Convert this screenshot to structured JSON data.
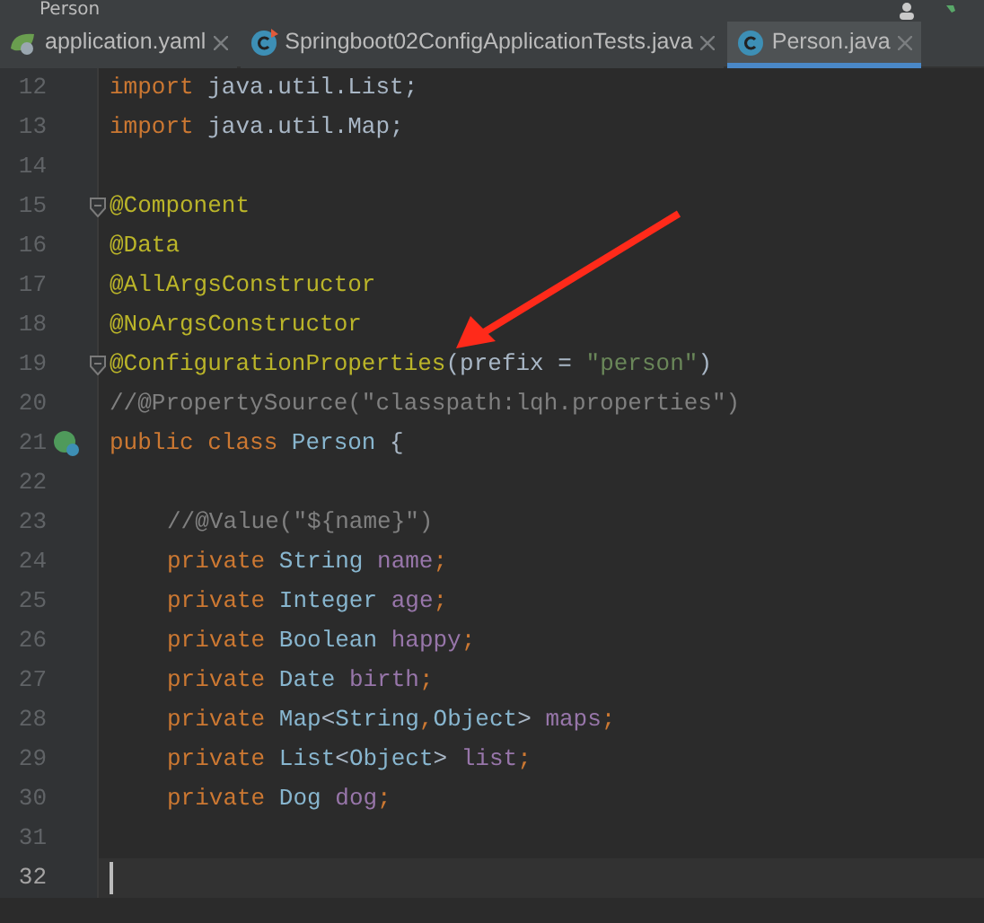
{
  "breadcrumb": "Person",
  "tabs": [
    {
      "label": "application.yaml",
      "kind": "yaml",
      "selected": false
    },
    {
      "label": "Springboot02ConfigApplicationTests.java",
      "kind": "test",
      "selected": false
    },
    {
      "label": "Person.java",
      "kind": "class",
      "selected": true
    }
  ],
  "editor": {
    "lines": [
      {
        "number": "12",
        "tokens": [
          {
            "kind": "keyword",
            "text": "import"
          },
          {
            "kind": "plain",
            "text": " java.util.List;"
          }
        ]
      },
      {
        "number": "13",
        "tokens": [
          {
            "kind": "keyword",
            "text": "import"
          },
          {
            "kind": "plain",
            "text": " java.util.Map;"
          }
        ]
      },
      {
        "number": "14"
      },
      {
        "number": "15",
        "fold": true,
        "tokens": [
          {
            "kind": "annotation",
            "text": "@Component"
          }
        ]
      },
      {
        "number": "16",
        "tokens": [
          {
            "kind": "annotation",
            "text": "@Data"
          }
        ]
      },
      {
        "number": "17",
        "tokens": [
          {
            "kind": "annotation",
            "text": "@AllArgsConstructor"
          }
        ]
      },
      {
        "number": "18",
        "tokens": [
          {
            "kind": "annotation",
            "text": "@NoArgsConstructor"
          }
        ]
      },
      {
        "number": "19",
        "fold": true,
        "tokens": [
          {
            "kind": "annotation",
            "text": "@ConfigurationProperties"
          },
          {
            "kind": "plain",
            "text": "("
          },
          {
            "kind": "param",
            "text": "prefix"
          },
          {
            "kind": "plain",
            "text": " = "
          },
          {
            "kind": "string",
            "text": "\"person\""
          },
          {
            "kind": "plain",
            "text": ")"
          }
        ]
      },
      {
        "number": "20",
        "tokens": [
          {
            "kind": "comment",
            "text": "//@PropertySource(\"classpath:lqh.properties\")"
          }
        ]
      },
      {
        "number": "21",
        "bean": true,
        "tokens": [
          {
            "kind": "keyword",
            "text": "public class "
          },
          {
            "kind": "type",
            "text": "Person"
          },
          {
            "kind": "plain",
            "text": " {"
          }
        ]
      },
      {
        "number": "22"
      },
      {
        "number": "23",
        "indented": true,
        "tokens": [
          {
            "kind": "comment",
            "text": "//@Value(\"${name}\")"
          }
        ]
      },
      {
        "number": "24",
        "indented": true,
        "tokens": [
          {
            "kind": "keyword",
            "text": "private "
          },
          {
            "kind": "type",
            "text": "String "
          },
          {
            "kind": "field",
            "text": "name"
          },
          {
            "kind": "keyword",
            "text": ";"
          }
        ]
      },
      {
        "number": "25",
        "indented": true,
        "tokens": [
          {
            "kind": "keyword",
            "text": "private "
          },
          {
            "kind": "type",
            "text": "Integer "
          },
          {
            "kind": "field",
            "text": "age"
          },
          {
            "kind": "keyword",
            "text": ";"
          }
        ]
      },
      {
        "number": "26",
        "indented": true,
        "tokens": [
          {
            "kind": "keyword",
            "text": "private "
          },
          {
            "kind": "type",
            "text": "Boolean "
          },
          {
            "kind": "field",
            "text": "happy"
          },
          {
            "kind": "keyword",
            "text": ";"
          }
        ]
      },
      {
        "number": "27",
        "indented": true,
        "tokens": [
          {
            "kind": "keyword",
            "text": "private "
          },
          {
            "kind": "type",
            "text": "Date "
          },
          {
            "kind": "field",
            "text": "birth"
          },
          {
            "kind": "keyword",
            "text": ";"
          }
        ]
      },
      {
        "number": "28",
        "indented": true,
        "tokens": [
          {
            "kind": "keyword",
            "text": "private "
          },
          {
            "kind": "type",
            "text": "Map"
          },
          {
            "kind": "plain",
            "text": "<"
          },
          {
            "kind": "type",
            "text": "String"
          },
          {
            "kind": "keyword",
            "text": ","
          },
          {
            "kind": "type",
            "text": "Object"
          },
          {
            "kind": "plain",
            "text": "> "
          },
          {
            "kind": "field",
            "text": "maps"
          },
          {
            "kind": "keyword",
            "text": ";"
          }
        ]
      },
      {
        "number": "29",
        "indented": true,
        "tokens": [
          {
            "kind": "keyword",
            "text": "private "
          },
          {
            "kind": "type",
            "text": "List"
          },
          {
            "kind": "plain",
            "text": "<"
          },
          {
            "kind": "type",
            "text": "Object"
          },
          {
            "kind": "plain",
            "text": "> "
          },
          {
            "kind": "field",
            "text": "list"
          },
          {
            "kind": "keyword",
            "text": ";"
          }
        ]
      },
      {
        "number": "30",
        "indented": true,
        "tokens": [
          {
            "kind": "keyword",
            "text": "private "
          },
          {
            "kind": "type",
            "text": "Dog "
          },
          {
            "kind": "field",
            "text": "dog"
          },
          {
            "kind": "keyword",
            "text": ";"
          }
        ]
      },
      {
        "number": "31"
      },
      {
        "number": "32",
        "current": true
      }
    ]
  }
}
